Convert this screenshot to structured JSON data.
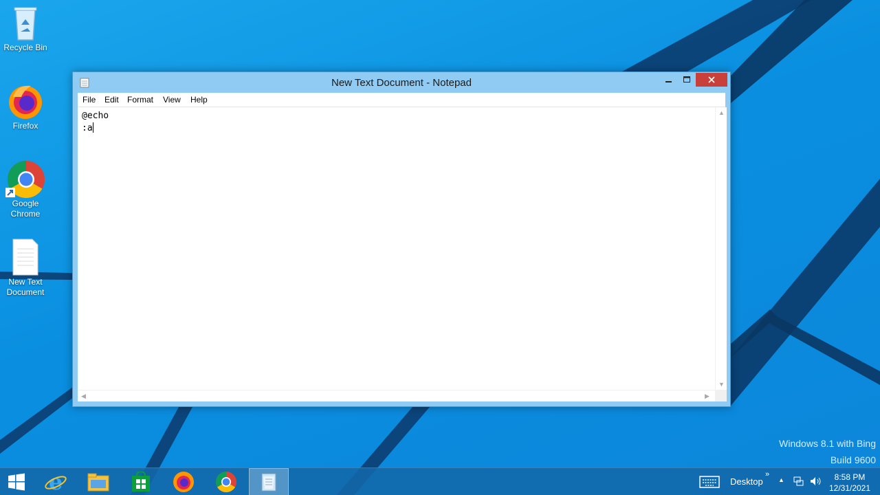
{
  "desktop": {
    "icons": [
      {
        "label": "Recycle Bin"
      },
      {
        "label": "Firefox"
      },
      {
        "label": "Google Chrome"
      },
      {
        "label": "New Text Document"
      }
    ],
    "watermark_line1": "Windows 8.1 with Bing",
    "watermark_line2": "Build 9600"
  },
  "window": {
    "title": "New Text Document - Notepad",
    "menu": [
      "File",
      "Edit",
      "Format",
      "View",
      "Help"
    ],
    "content_line1": "@echo",
    "content_line2": ":a"
  },
  "taskbar": {
    "pinned": [
      "start-icon",
      "internet-explorer-icon",
      "file-explorer-icon",
      "store-icon",
      "firefox-icon",
      "chrome-icon",
      "notepad-icon"
    ],
    "desktop_label": "Desktop",
    "time": "8:58 PM",
    "date": "12/31/2021"
  },
  "colors": {
    "wallpaper": "#0c8fe0",
    "close_button": "#c9403a",
    "title_bar": "#8fcbf3"
  }
}
